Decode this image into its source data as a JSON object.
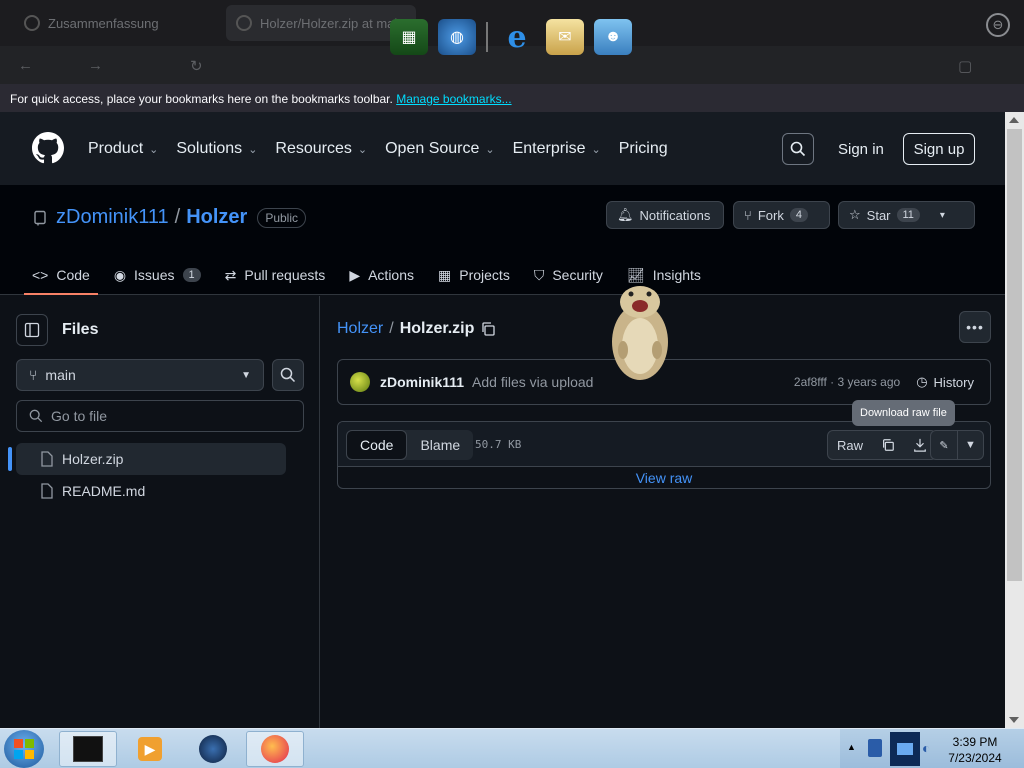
{
  "browser": {
    "tabs": [
      {
        "title": "Zusammenfassung"
      },
      {
        "title": "Holzer/Holzer.zip at main"
      }
    ],
    "bookmarks_bar": {
      "message": "For quick access, place your bookmarks here on the bookmarks toolbar.",
      "link": "Manage bookmarks..."
    }
  },
  "github": {
    "nav": [
      "Product",
      "Solutions",
      "Resources",
      "Open Source",
      "Enterprise",
      "Pricing"
    ],
    "sign_in": "Sign in",
    "sign_up": "Sign up"
  },
  "repo": {
    "owner": "zDominik111",
    "name": "Holzer",
    "visibility": "Public",
    "notifications_label": "Notifications",
    "fork_label": "Fork",
    "fork_count": "4",
    "star_label": "Star",
    "star_count": "11",
    "tabs": [
      {
        "label": "Code",
        "count": ""
      },
      {
        "label": "Issues",
        "count": "1"
      },
      {
        "label": "Pull requests",
        "count": ""
      },
      {
        "label": "Actions",
        "count": ""
      },
      {
        "label": "Projects",
        "count": ""
      },
      {
        "label": "Security",
        "count": ""
      },
      {
        "label": "Insights",
        "count": ""
      }
    ]
  },
  "sidebar": {
    "title": "Files",
    "branch": "main",
    "goto_placeholder": "Go to file",
    "files": [
      "Holzer.zip",
      "README.md"
    ]
  },
  "file_view": {
    "breadcrumb_repo": "Holzer",
    "breadcrumb_sep": "/",
    "breadcrumb_file": "Holzer.zip",
    "commit_author": "zDominik111",
    "commit_message": "Add files via upload",
    "commit_meta": "2af8fff · 3 years ago",
    "history_label": "History",
    "tooltip": "Download raw file",
    "code_tab": "Code",
    "blame_tab": "Blame",
    "file_size": "50.7 KB",
    "raw_label": "Raw",
    "view_raw": "View raw"
  },
  "taskbar": {
    "time": "3:39 PM",
    "date": "7/23/2024"
  },
  "colors": {
    "accent": "#4493f8",
    "tab_underline": "#f78166",
    "background": "#0d1117"
  }
}
